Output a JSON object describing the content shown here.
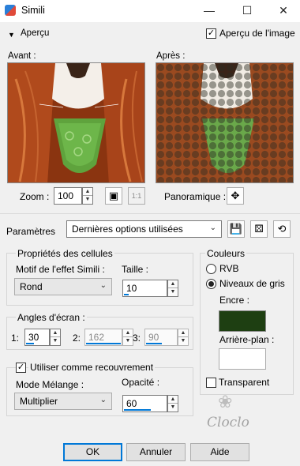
{
  "window": {
    "title": "Simili",
    "minimize_icon": "minimize-icon",
    "maximize_icon": "maximize-icon",
    "close_icon": "close-icon"
  },
  "apercu": {
    "toggle_label": "Aperçu",
    "checkbox_label": "Aperçu de l'image",
    "checked": true
  },
  "previews": {
    "before_label": "Avant :",
    "after_label": "Après :"
  },
  "zoom": {
    "label": "Zoom :",
    "value": "100"
  },
  "panoramique": {
    "label": "Panoramique :"
  },
  "parametres": {
    "label": "Paramètres",
    "selected": "Dernières options utilisées"
  },
  "cellules": {
    "title": "Propriétés des cellules",
    "motif_label": "Motif de l'effet Simili :",
    "motif_value": "Rond",
    "taille_label": "Taille :",
    "taille_value": "10"
  },
  "angles": {
    "title": "Angles d'écran :",
    "a1_label": "1:",
    "a1_value": "30",
    "a2_label": "2:",
    "a2_value": "162",
    "a3_label": "3:",
    "a3_value": "90"
  },
  "recouvrement": {
    "checkbox_label": "Utiliser comme recouvrement",
    "checked": true,
    "mode_label": "Mode Mélange :",
    "mode_value": "Multiplier",
    "opacite_label": "Opacité :",
    "opacite_value": "60"
  },
  "couleurs": {
    "title": "Couleurs",
    "rvb_label": "RVB",
    "niveaux_label": "Niveaux de gris",
    "encre_label": "Encre :",
    "encre_color": "#1e3f12",
    "arriere_label": "Arrière-plan :",
    "arriere_color": "#ffffff",
    "transparent_label": "Transparent"
  },
  "watermark": {
    "text": "Cloclo"
  },
  "buttons": {
    "ok": "OK",
    "annuler": "Annuler",
    "aide": "Aide"
  },
  "colors": {
    "accent": "#0078d7",
    "panel": "#f0f0f0"
  }
}
